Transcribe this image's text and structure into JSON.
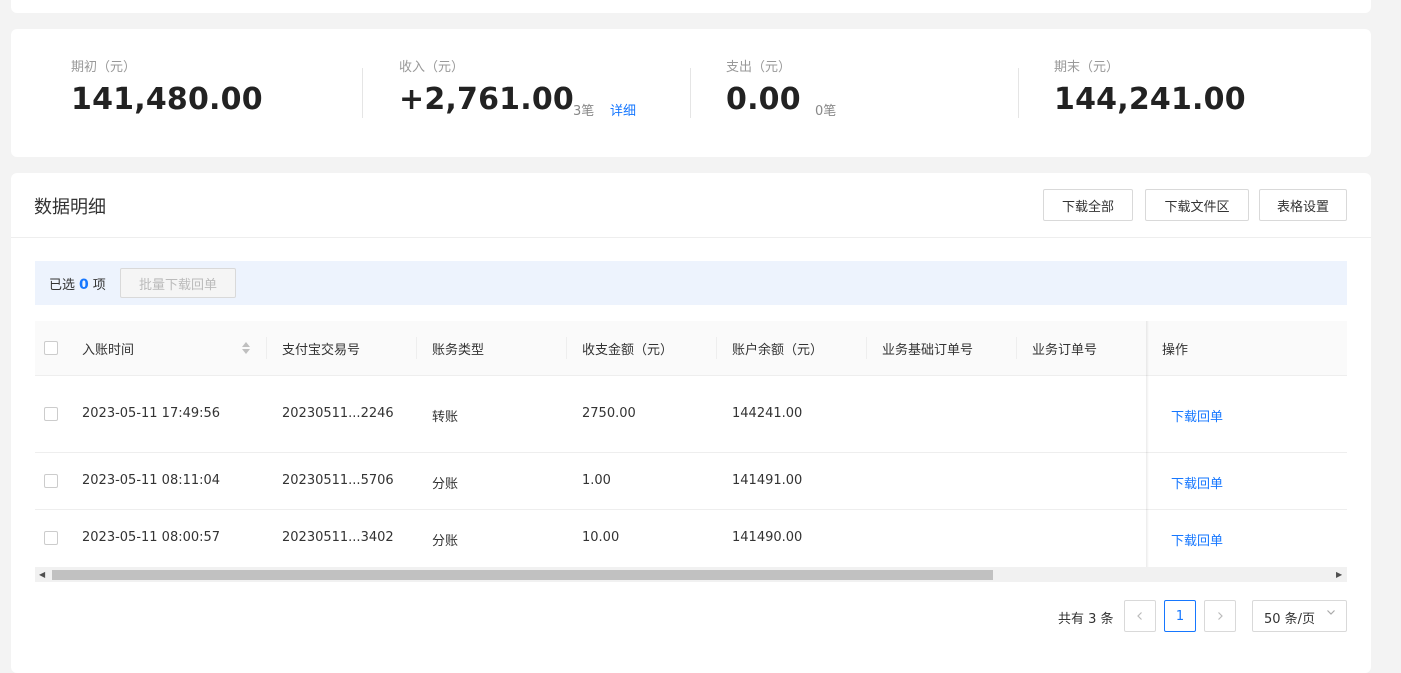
{
  "summary": {
    "opening": {
      "label": "期初（元）",
      "value": "141,480.00"
    },
    "income": {
      "label": "收入（元）",
      "value": "+2,761.00",
      "count": "3笔",
      "detail_link": "详细"
    },
    "expense": {
      "label": "支出（元）",
      "value": "0.00",
      "count": "0笔"
    },
    "closing": {
      "label": "期末（元）",
      "value": "144,241.00"
    }
  },
  "detail": {
    "title": "数据明细",
    "buttons": {
      "download_all": "下载全部",
      "download_files": "下载文件区",
      "table_settings": "表格设置"
    },
    "selection": {
      "prefix": "已选",
      "count": "0",
      "suffix": "项",
      "batch_button": "批量下载回单"
    },
    "columns": [
      "入账时间",
      "支付宝交易号",
      "账务类型",
      "收支金额（元）",
      "账户余额（元）",
      "业务基础订单号",
      "业务订单号",
      "操作"
    ],
    "rows": [
      {
        "time": "2023-05-11 17:49:56",
        "trade_no": "20230511...2246",
        "type": "转账",
        "amount": "2750.00",
        "balance": "144241.00",
        "base_order": "",
        "order": "",
        "action": "下载回单"
      },
      {
        "time": "2023-05-11 08:11:04",
        "trade_no": "20230511...5706",
        "type": "分账",
        "amount": "1.00",
        "balance": "141491.00",
        "base_order": "",
        "order": "",
        "action": "下载回单"
      },
      {
        "time": "2023-05-11 08:00:57",
        "trade_no": "20230511...3402",
        "type": "分账",
        "amount": "10.00",
        "balance": "141490.00",
        "base_order": "",
        "order": "",
        "action": "下载回单"
      }
    ]
  },
  "pagination": {
    "total_text": "共有 3 条",
    "current_page": "1",
    "prev_icon": "chevron-left-icon",
    "next_icon": "chevron-right-icon",
    "page_size": "50 条/页",
    "page_size_icon": "chevron-down-icon"
  },
  "colors": {
    "accent": "#1677ff",
    "selection_bg": "#edf3fd",
    "page_bg": "#f3f3f3"
  }
}
